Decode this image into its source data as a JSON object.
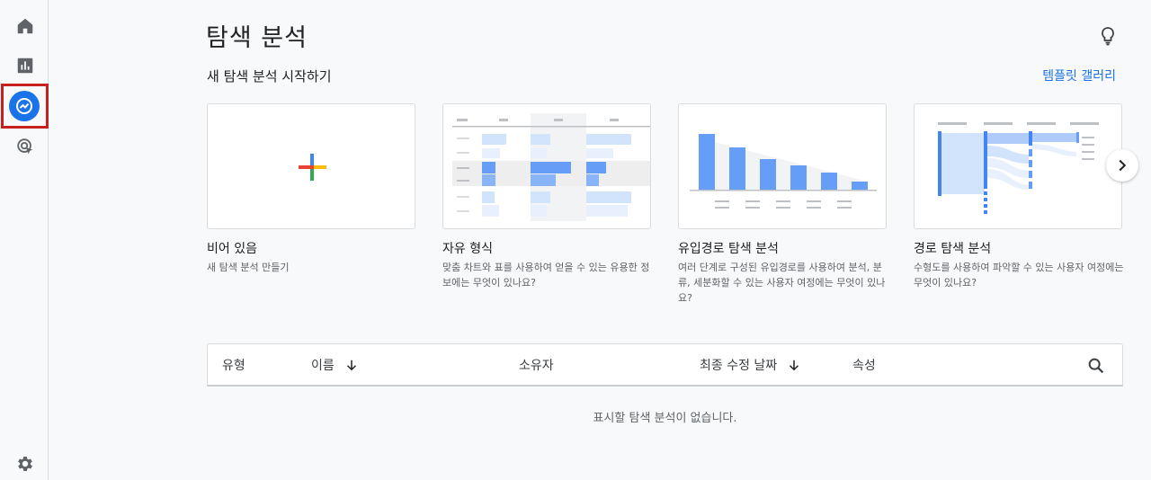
{
  "rail": {
    "items": [
      {
        "name": "home-icon"
      },
      {
        "name": "reports-icon"
      },
      {
        "name": "explore-icon",
        "active": true
      },
      {
        "name": "advertising-icon"
      }
    ],
    "settings": {
      "name": "gear-icon"
    },
    "active_color": "#1a73e8",
    "highlight_color": "#c5221f"
  },
  "header": {
    "title": "탐색 분석",
    "help_icon": "lightbulb-icon"
  },
  "templates": {
    "section_title": "새 탐색 분석 시작하기",
    "gallery_link": "템플릿 갤러리",
    "cards": [
      {
        "label": "비어 있음",
        "desc": "새 탐색 분석 만들기"
      },
      {
        "label": "자유 형식",
        "desc": "맞춤 차트와 표를 사용하여 얻을 수 있는 유용한 정보에는 무엇이 있나요?"
      },
      {
        "label": "유입경로 탐색 분석",
        "desc": "여러 단계로 구성된 유입경로를 사용하여 분석, 분류, 세분화할 수 있는 사용자 여정에는 무엇이 있나요?"
      },
      {
        "label": "경로 탐색 분석",
        "desc": "수형도를 사용하여 파악할 수 있는 사용자 여정에는 무엇이 있나요?"
      }
    ],
    "next_icon": "chevron-right-icon"
  },
  "table": {
    "columns": [
      {
        "label": "유형",
        "sortable": false
      },
      {
        "label": "이름",
        "sortable": true
      },
      {
        "label": "소유자",
        "sortable": false
      },
      {
        "label": "최종 수정 날짜",
        "sortable": true
      },
      {
        "label": "속성",
        "sortable": false
      }
    ],
    "empty_message": "표시할 탐색 분석이 없습니다."
  }
}
